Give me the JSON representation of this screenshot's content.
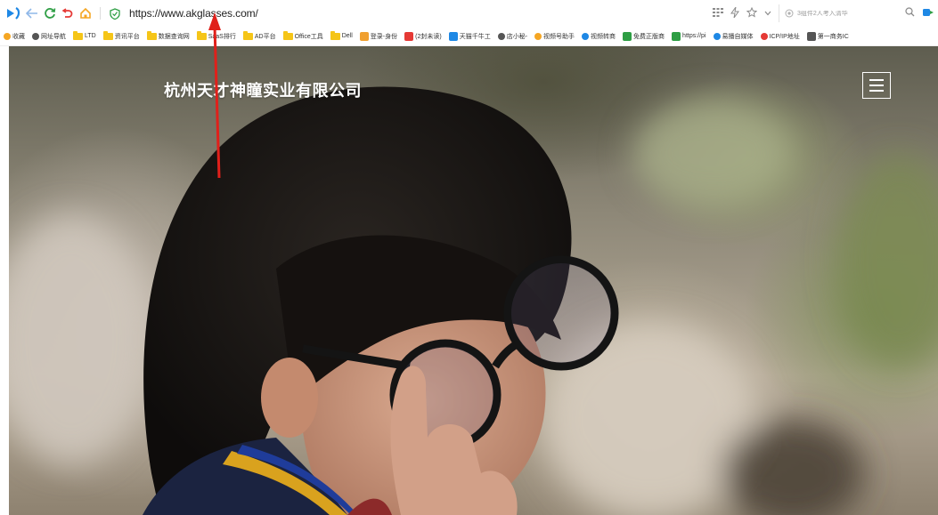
{
  "browser": {
    "url": "https://www.akglasses.com/",
    "search_placeholder": "3组件2人考入清华"
  },
  "bookmarks": [
    {
      "label": "收藏",
      "icon": "star-icon",
      "color": "#f5a623"
    },
    {
      "label": "网址导航",
      "icon": "globe-icon",
      "color": "#555555"
    },
    {
      "label": "LTD",
      "icon": "folder-icon",
      "color": "#f5c518"
    },
    {
      "label": "资讯平台",
      "icon": "folder-icon",
      "color": "#f5c518"
    },
    {
      "label": "数据查询网",
      "icon": "folder-icon",
      "color": "#f5c518"
    },
    {
      "label": "SaaS排行",
      "icon": "folder-icon",
      "color": "#f5c518"
    },
    {
      "label": "AD平台",
      "icon": "folder-icon",
      "color": "#f5c518"
    },
    {
      "label": "Office工具",
      "icon": "folder-icon",
      "color": "#f5c518"
    },
    {
      "label": "Dell",
      "icon": "folder-icon",
      "color": "#f5c518"
    },
    {
      "label": "登录-身份",
      "icon": "square-icon",
      "color": "#f0a030"
    },
    {
      "label": "(2封未读)",
      "icon": "mail-icon",
      "color": "#e53935"
    },
    {
      "label": "天猫千牛工",
      "icon": "square-icon",
      "color": "#1e88e5"
    },
    {
      "label": "店小秘-",
      "icon": "check-icon",
      "color": "#555555"
    },
    {
      "label": "视频号助手",
      "icon": "butterfly-icon",
      "color": "#f5a623"
    },
    {
      "label": "视频转商",
      "icon": "wave-icon",
      "color": "#1e88e5"
    },
    {
      "label": "免费正版商",
      "icon": "square-icon",
      "color": "#2e9e44"
    },
    {
      "label": "https://pi",
      "icon": "square-icon",
      "color": "#2e9e44"
    },
    {
      "label": "易播自媒体",
      "icon": "person-icon",
      "color": "#1e88e5"
    },
    {
      "label": "ICP/IP地址",
      "icon": "pin-icon",
      "color": "#e53935"
    },
    {
      "label": "第一商务IC",
      "icon": "square-icon",
      "color": "#555555"
    }
  ],
  "site": {
    "title": "杭州天才神瞳实业有限公司"
  }
}
